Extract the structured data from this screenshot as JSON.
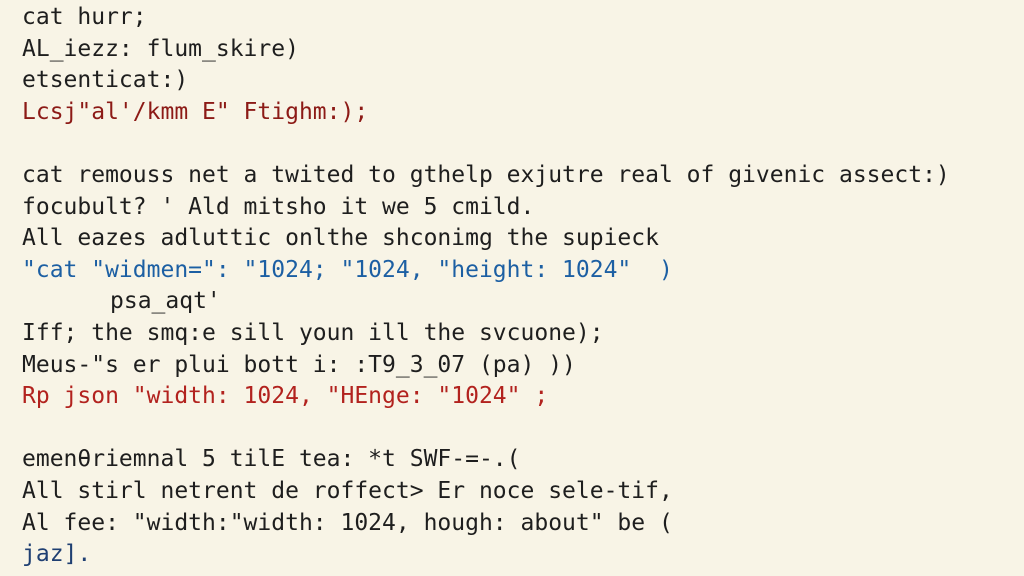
{
  "terminal": {
    "lines": [
      {
        "text": "cat hurr;",
        "color": "#1e1e1e"
      },
      {
        "text": "AL_iezz: flum_skire)",
        "color": "#1e1e1e"
      },
      {
        "text": "etsenticat:)",
        "color": "#1e1e1e"
      },
      {
        "text": "Lcsj\"al'/kmm E\" Ftighm:);",
        "color": "#8c1a16"
      },
      {
        "text": "",
        "color": "#1e1e1e"
      },
      {
        "text": "cat remouss net a twited to gthelp exjutre real of givenic assect:)",
        "color": "#1e1e1e"
      },
      {
        "text": "focubult? ' Ald mitsho it we 5 cmild.",
        "color": "#1e1e1e"
      },
      {
        "text": "All eazes adluttic onlthe shconimg the supieck",
        "color": "#1e1e1e"
      },
      {
        "text": "\"cat \"widmen=\": \"1024; \"1024, \"height: 1024\"  )",
        "color": "#1c5fa3"
      },
      {
        "text": "psa_aqt'",
        "color": "#1e1e1e"
      },
      {
        "text": "Iff; the smq:e sill youn ill the svcuone);",
        "color": "#1e1e1e"
      },
      {
        "text": "Meus-\"s er plui bott i: :T9_3_07 (pa) ))",
        "color": "#1e1e1e"
      },
      {
        "text": "Rp json \"width: 1024, \"HEnge: \"1024\" ;",
        "color": "#b2221e"
      },
      {
        "text": "",
        "color": "#1e1e1e"
      },
      {
        "text": "emenθriemnal 5 tilE tea: *t SWF-=-.(",
        "color": "#1e1e1e"
      },
      {
        "text": "All stirl netrent de roffect> Er noce sele-tif,",
        "color": "#1e1e1e"
      },
      {
        "text": "Al fee: \"width:\"width: 1024, hough: about\" be (",
        "color": "#1e1e1e"
      },
      {
        "text": "jaz].",
        "color": "#1f3f72"
      }
    ]
  }
}
